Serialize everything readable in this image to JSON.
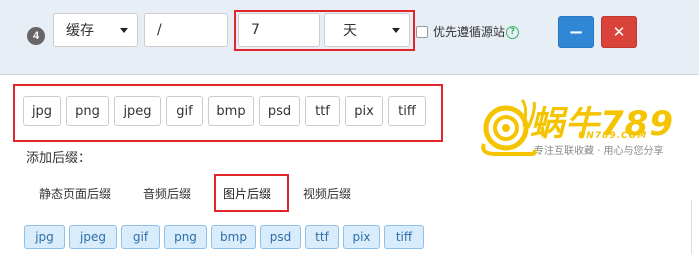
{
  "rule": {
    "index": "4",
    "type_select": "缓存",
    "path_input": "/",
    "duration_input": "7",
    "unit_select": "天",
    "prefer_origin_label": "优先遵循源站",
    "help_symbol": "?",
    "minus_symbol": "−",
    "close_symbol": "✕"
  },
  "extensions": [
    "jpg",
    "png",
    "jpeg",
    "gif",
    "bmp",
    "psd",
    "ttf",
    "pix",
    "tiff"
  ],
  "add_suffix_label": "添加后缀：",
  "tabs": [
    "静态页面后缀",
    "音频后缀",
    "图片后缀",
    "视频后缀"
  ],
  "active_tab": "图片后缀",
  "suffix_tags": [
    "jpg",
    "jpeg",
    "gif",
    "png",
    "bmp",
    "psd",
    "ttf",
    "pix",
    "tiff"
  ],
  "logo": {
    "title": "蜗牛789",
    "domain": "UN789.COM",
    "slogan": "专注互联收藏 · 用心与您分享"
  },
  "colors": {
    "highlight": "#e0252b",
    "primary": "#2f87d6",
    "danger": "#d9433a",
    "tag_bg": "#d9ecfb",
    "logo": "#f5c400"
  }
}
